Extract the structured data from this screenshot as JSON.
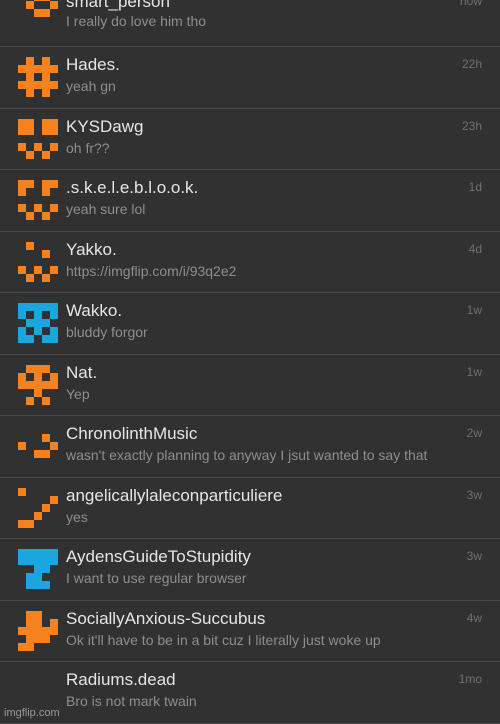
{
  "accent_colors": {
    "orange": "#f6821f",
    "blue": "#1aa7e0"
  },
  "messages": [
    {
      "name": "smart_person",
      "preview": "I really do love him tho",
      "time": "now",
      "avatar": "orange-pixel-icon-1",
      "color": "#f6821f",
      "pix": [
        [
          2,
          0
        ],
        [
          3,
          0
        ],
        [
          1,
          1
        ],
        [
          4,
          1
        ],
        [
          2,
          2
        ],
        [
          3,
          2
        ]
      ]
    },
    {
      "name": "Hades.",
      "preview": "yeah gn",
      "time": "22h",
      "avatar": "orange-pixel-icon-2",
      "color": "#f6821f",
      "pix": [
        [
          1,
          0
        ],
        [
          3,
          0
        ],
        [
          0,
          1
        ],
        [
          1,
          1
        ],
        [
          2,
          1
        ],
        [
          3,
          1
        ],
        [
          4,
          1
        ],
        [
          1,
          2
        ],
        [
          3,
          2
        ],
        [
          0,
          3
        ],
        [
          1,
          3
        ],
        [
          2,
          3
        ],
        [
          3,
          3
        ],
        [
          4,
          3
        ],
        [
          1,
          4
        ],
        [
          3,
          4
        ]
      ]
    },
    {
      "name": "KYSDawg",
      "preview": "oh fr??",
      "time": "23h",
      "avatar": "orange-pixel-icon-3",
      "color": "#f6821f",
      "pix": [
        [
          0,
          0
        ],
        [
          1,
          0
        ],
        [
          3,
          0
        ],
        [
          4,
          0
        ],
        [
          0,
          1
        ],
        [
          1,
          1
        ],
        [
          3,
          1
        ],
        [
          4,
          1
        ],
        [
          0,
          3
        ],
        [
          2,
          3
        ],
        [
          4,
          3
        ],
        [
          1,
          4
        ],
        [
          3,
          4
        ]
      ]
    },
    {
      "name": ".s.k.e.l.e.b.l.o.o.k.",
      "preview": "yeah sure lol",
      "time": "1d",
      "avatar": "orange-pixel-icon-4",
      "color": "#f6821f",
      "pix": [
        [
          0,
          0
        ],
        [
          1,
          0
        ],
        [
          3,
          0
        ],
        [
          4,
          0
        ],
        [
          0,
          1
        ],
        [
          3,
          1
        ],
        [
          0,
          3
        ],
        [
          2,
          3
        ],
        [
          4,
          3
        ],
        [
          1,
          4
        ],
        [
          3,
          4
        ]
      ]
    },
    {
      "name": "Yakko.",
      "preview": "https://imgflip.com/i/93q2e2",
      "time": "4d",
      "avatar": "orange-pixel-icon-5",
      "color": "#f6821f",
      "pix": [
        [
          1,
          0
        ],
        [
          3,
          1
        ],
        [
          0,
          3
        ],
        [
          2,
          3
        ],
        [
          4,
          3
        ],
        [
          1,
          4
        ],
        [
          3,
          4
        ]
      ]
    },
    {
      "name": "Wakko.",
      "preview": "bluddy forgor",
      "time": "1w",
      "avatar": "blue-pixel-icon-1",
      "color": "#1aa7e0",
      "pix": [
        [
          0,
          0
        ],
        [
          1,
          0
        ],
        [
          2,
          0
        ],
        [
          3,
          0
        ],
        [
          4,
          0
        ],
        [
          0,
          1
        ],
        [
          2,
          1
        ],
        [
          4,
          1
        ],
        [
          1,
          2
        ],
        [
          2,
          2
        ],
        [
          3,
          2
        ],
        [
          0,
          3
        ],
        [
          2,
          3
        ],
        [
          4,
          3
        ],
        [
          0,
          4
        ],
        [
          1,
          4
        ],
        [
          3,
          4
        ],
        [
          4,
          4
        ]
      ]
    },
    {
      "name": "Nat.",
      "preview": "Yep",
      "time": "1w",
      "avatar": "orange-pixel-icon-6",
      "color": "#f6821f",
      "pix": [
        [
          1,
          0
        ],
        [
          2,
          0
        ],
        [
          3,
          0
        ],
        [
          0,
          1
        ],
        [
          2,
          1
        ],
        [
          4,
          1
        ],
        [
          0,
          2
        ],
        [
          1,
          2
        ],
        [
          2,
          2
        ],
        [
          3,
          2
        ],
        [
          4,
          2
        ],
        [
          2,
          3
        ],
        [
          1,
          4
        ],
        [
          3,
          4
        ]
      ]
    },
    {
      "name": "ChronolinthMusic",
      "preview": "wasn't exactly planning to anyway I jsut wanted to say that",
      "time": "2w",
      "avatar": "orange-pixel-icon-7",
      "color": "#f6821f",
      "pix": [
        [
          3,
          1
        ],
        [
          0,
          2
        ],
        [
          4,
          2
        ],
        [
          2,
          3
        ],
        [
          3,
          3
        ]
      ]
    },
    {
      "name": "angelicallylaleconparticuliere",
      "preview": "yes",
      "time": "3w",
      "avatar": "orange-pixel-icon-8",
      "color": "#f6821f",
      "pix": [
        [
          0,
          0
        ],
        [
          4,
          1
        ],
        [
          3,
          2
        ],
        [
          2,
          3
        ],
        [
          0,
          4
        ],
        [
          1,
          4
        ]
      ]
    },
    {
      "name": "AydensGuideToStupidity",
      "preview": "I want to use regular browser",
      "time": "3w",
      "avatar": "blue-pixel-icon-2",
      "color": "#1aa7e0",
      "pix": [
        [
          0,
          0
        ],
        [
          1,
          0
        ],
        [
          2,
          0
        ],
        [
          3,
          0
        ],
        [
          4,
          0
        ],
        [
          0,
          1
        ],
        [
          1,
          1
        ],
        [
          2,
          1
        ],
        [
          3,
          1
        ],
        [
          4,
          1
        ],
        [
          2,
          2
        ],
        [
          3,
          2
        ],
        [
          1,
          3
        ],
        [
          2,
          3
        ],
        [
          1,
          4
        ],
        [
          2,
          4
        ],
        [
          3,
          4
        ]
      ]
    },
    {
      "name": "SociallyAnxious-Succubus",
      "preview": "Ok it'll have to be in a bit cuz I literally just woke up",
      "time": "4w",
      "avatar": "orange-pixel-icon-9",
      "color": "#f6821f",
      "pix": [
        [
          1,
          0
        ],
        [
          2,
          0
        ],
        [
          1,
          1
        ],
        [
          2,
          1
        ],
        [
          4,
          1
        ],
        [
          0,
          2
        ],
        [
          1,
          2
        ],
        [
          2,
          2
        ],
        [
          3,
          2
        ],
        [
          4,
          2
        ],
        [
          1,
          3
        ],
        [
          2,
          3
        ],
        [
          3,
          3
        ],
        [
          0,
          4
        ],
        [
          1,
          4
        ]
      ]
    },
    {
      "name": "Radiums.dead",
      "preview": "Bro is not mark twain",
      "time": "1mo",
      "avatar": "none",
      "color": "#313131",
      "pix": []
    }
  ],
  "watermark": "imgflip.com"
}
